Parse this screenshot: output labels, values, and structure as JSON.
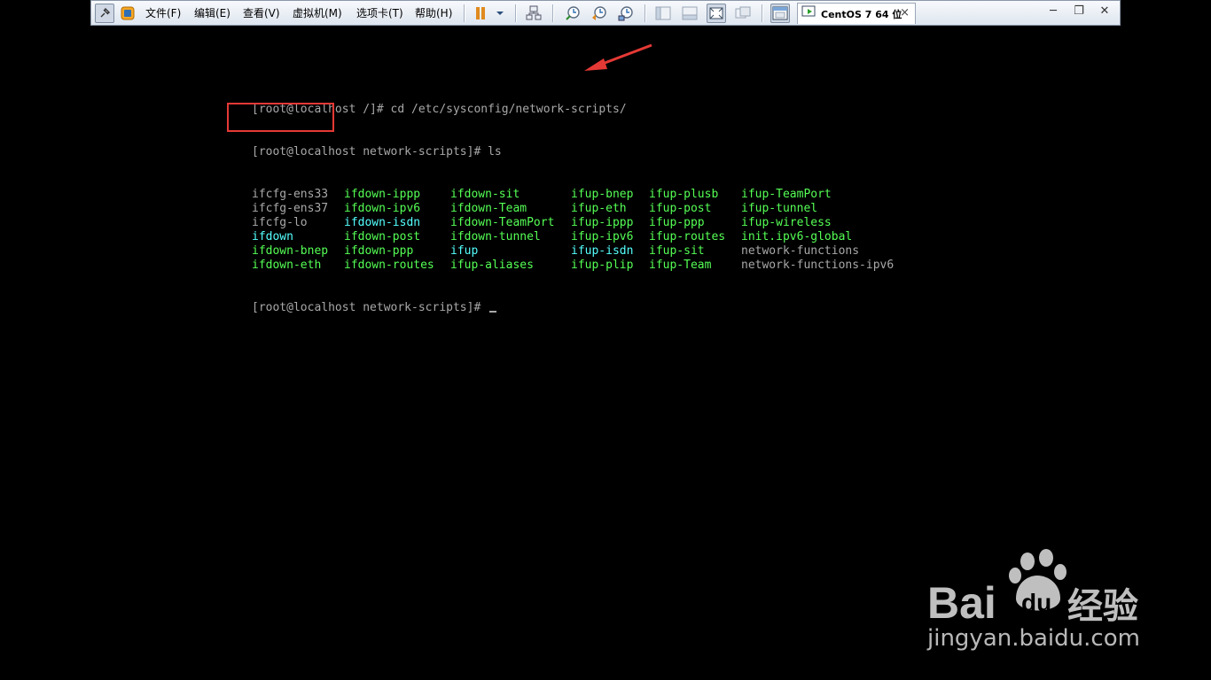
{
  "toolbar": {
    "menu": {
      "file": "文件(F)",
      "edit": "编辑(E)",
      "view": "查看(V)",
      "vm": "虚拟机(M)",
      "tabs": "选项卡(T)",
      "help": "帮助(H)"
    },
    "vm_tab_label": "CentOS 7 64 位",
    "tab_close": "×",
    "window_minimize": "─",
    "window_restore": "❐",
    "window_close": "✕",
    "icons": [
      "pin-icon",
      "vmware-home-icon",
      "pause-icon",
      "dropdown-arrow-icon",
      "network-icon",
      "snapshot-icon",
      "revert-snapshot-icon",
      "snapshot-manager-icon",
      "sidebar-view-icon",
      "console-view-icon",
      "fullscreen-icon",
      "unity-icon",
      "thumbnail-view-icon",
      "vm-running-icon"
    ]
  },
  "terminal": {
    "line1": "[root@localhost /]# cd /etc/sysconfig/network-scripts/",
    "line2": "[root@localhost network-scripts]# ls",
    "ls_rows": [
      [
        {
          "t": "ifcfg-ens33",
          "c": "white"
        },
        {
          "t": "ifdown-ippp",
          "c": "green"
        },
        {
          "t": "ifdown-sit",
          "c": "green"
        },
        {
          "t": "ifup-bnep",
          "c": "green"
        },
        {
          "t": "ifup-plusb",
          "c": "green"
        },
        {
          "t": "ifup-TeamPort",
          "c": "green"
        }
      ],
      [
        {
          "t": "ifcfg-ens37",
          "c": "white"
        },
        {
          "t": "ifdown-ipv6",
          "c": "green"
        },
        {
          "t": "ifdown-Team",
          "c": "green"
        },
        {
          "t": "ifup-eth",
          "c": "green"
        },
        {
          "t": "ifup-post",
          "c": "green"
        },
        {
          "t": "ifup-tunnel",
          "c": "green"
        }
      ],
      [
        {
          "t": "ifcfg-lo",
          "c": "white"
        },
        {
          "t": "ifdown-isdn",
          "c": "cyan"
        },
        {
          "t": "ifdown-TeamPort",
          "c": "green"
        },
        {
          "t": "ifup-ippp",
          "c": "green"
        },
        {
          "t": "ifup-ppp",
          "c": "green"
        },
        {
          "t": "ifup-wireless",
          "c": "green"
        }
      ],
      [
        {
          "t": "ifdown",
          "c": "cyan"
        },
        {
          "t": "ifdown-post",
          "c": "green"
        },
        {
          "t": "ifdown-tunnel",
          "c": "green"
        },
        {
          "t": "ifup-ipv6",
          "c": "green"
        },
        {
          "t": "ifup-routes",
          "c": "green"
        },
        {
          "t": "init.ipv6-global",
          "c": "green"
        }
      ],
      [
        {
          "t": "ifdown-bnep",
          "c": "green"
        },
        {
          "t": "ifdown-ppp",
          "c": "green"
        },
        {
          "t": "ifup",
          "c": "cyan"
        },
        {
          "t": "ifup-isdn",
          "c": "cyan"
        },
        {
          "t": "ifup-sit",
          "c": "green"
        },
        {
          "t": "network-functions",
          "c": "white"
        }
      ],
      [
        {
          "t": "ifdown-eth",
          "c": "green"
        },
        {
          "t": "ifdown-routes",
          "c": "green"
        },
        {
          "t": "ifup-aliases",
          "c": "green"
        },
        {
          "t": "ifup-plip",
          "c": "green"
        },
        {
          "t": "ifup-Team",
          "c": "green"
        },
        {
          "t": "network-functions-ipv6",
          "c": "white"
        }
      ]
    ],
    "prompt_final": "[root@localhost network-scripts]# ",
    "colors": {
      "white": "#a8a8a8",
      "green": "#55ff55",
      "cyan": "#55ffff"
    }
  },
  "annotations": {
    "highlight_color": "#e53935",
    "arrow_color": "#e53935"
  },
  "watermark": {
    "logo_text_bai": "Bai",
    "logo_text_du": "du",
    "logo_text_cn": "经验",
    "url": "jingyan.baidu.com"
  }
}
